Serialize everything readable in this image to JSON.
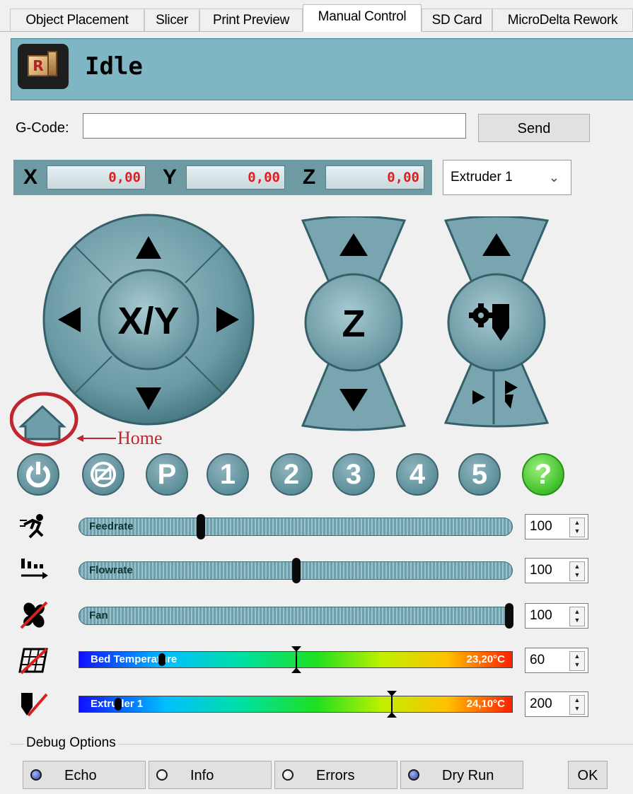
{
  "tabs": [
    {
      "label": "Object Placement",
      "active": false
    },
    {
      "label": "Slicer",
      "active": false
    },
    {
      "label": "Print Preview",
      "active": false
    },
    {
      "label": "Manual Control",
      "active": true
    },
    {
      "label": "SD Card",
      "active": false
    },
    {
      "label": "MicroDelta Rework",
      "active": false
    }
  ],
  "status": {
    "text": "Idle",
    "logo_letter": "R"
  },
  "gcode": {
    "label": "G-Code:",
    "value": "",
    "send_label": "Send"
  },
  "coords": {
    "x_label": "X",
    "x_value": "0,00",
    "y_label": "Y",
    "y_value": "0,00",
    "z_label": "Z",
    "z_value": "0,00",
    "extruder_selected": "Extruder 1"
  },
  "jog": {
    "xy_label": "X/Y",
    "z_label": "Z",
    "home_annotation": "Home"
  },
  "round_buttons": [
    "1",
    "2",
    "3",
    "4",
    "5",
    "P",
    "?"
  ],
  "sliders": {
    "feedrate": {
      "label": "Feedrate",
      "value": "100",
      "thumb_fraction": 0.28
    },
    "flowrate": {
      "label": "Flowrate",
      "value": "100",
      "thumb_fraction": 0.5
    },
    "fan": {
      "label": "Fan",
      "value": "100",
      "thumb_fraction": 1.0
    }
  },
  "temps": {
    "bed": {
      "label": "Bed Temperature",
      "current": "23,20°C",
      "target": "60",
      "target_fraction": 0.5,
      "current_fraction": 0.19
    },
    "extruder": {
      "label": "Extruder 1",
      "current": "24,10°C",
      "target": "200",
      "target_fraction": 0.72,
      "current_fraction": 0.09
    }
  },
  "debug": {
    "title": "Debug Options",
    "echo": "Echo",
    "info": "Info",
    "errors": "Errors",
    "dry_run": "Dry Run",
    "ok": "OK"
  },
  "colors": {
    "panel": "#7fb6c3",
    "button": "#6e9aa4",
    "coord_value": "#e11d1d",
    "annotation": "#c0262e",
    "help": "#3fbf2a"
  }
}
